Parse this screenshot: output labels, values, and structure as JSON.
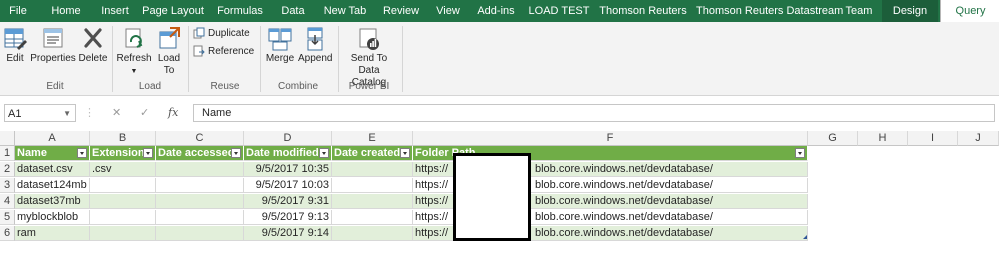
{
  "ribbon_tabs": [
    "File",
    "Home",
    "Insert",
    "Page Layout",
    "Formulas",
    "Data",
    "New Tab",
    "Review",
    "View",
    "Add-ins",
    "LOAD TEST",
    "Thomson Reuters",
    "Thomson Reuters Datastream",
    "Team",
    "Design",
    "Query"
  ],
  "active_tab": "Query",
  "ribbon": {
    "edit_group": {
      "label": "Edit",
      "buttons": [
        "Edit",
        "Properties",
        "Delete"
      ]
    },
    "load_group": {
      "label": "Load",
      "refresh": "Refresh",
      "load_to_line1": "Load",
      "load_to_line2": "To"
    },
    "reuse_group": {
      "label": "Reuse",
      "duplicate": "Duplicate",
      "reference": "Reference"
    },
    "combine_group": {
      "label": "Combine",
      "merge": "Merge",
      "append": "Append"
    },
    "powerbi_group": {
      "label": "Power BI",
      "send_line1": "Send To",
      "send_line2": "Data Catalog"
    }
  },
  "formula_bar": {
    "name_box": "A1",
    "cancel_icon": "✕",
    "enter_icon": "✓",
    "fx": "fx",
    "content": "Name"
  },
  "columns": [
    "A",
    "B",
    "C",
    "D",
    "E",
    "F",
    "G",
    "H",
    "I",
    "J"
  ],
  "rows": [
    "1",
    "2",
    "3",
    "4",
    "5",
    "6"
  ],
  "table": {
    "headers": [
      "Name",
      "Extension",
      "Date accessed",
      "Date modified",
      "Date created",
      "Folder Path"
    ],
    "data": [
      [
        "dataset.csv",
        ".csv",
        "",
        "9/5/2017 10:35",
        "",
        "https://",
        "blob.core.windows.net/devdatabase/"
      ],
      [
        "dataset124mb",
        "",
        "",
        "9/5/2017 10:03",
        "",
        "https://",
        "blob.core.windows.net/devdatabase/"
      ],
      [
        "dataset37mb",
        "",
        "",
        "9/5/2017 9:31",
        "",
        "https://",
        "blob.core.windows.net/devdatabase/"
      ],
      [
        "myblockblob",
        "",
        "",
        "9/5/2017 9:13",
        "",
        "https://",
        "blob.core.windows.net/devdatabase/"
      ],
      [
        "ram",
        "",
        "",
        "9/5/2017 9:14",
        "",
        "https://",
        "blob.core.windows.net/devdatabase/"
      ]
    ]
  },
  "colors": {
    "accent": "#217346",
    "table_header": "#70ad47",
    "band": "#e2efda"
  }
}
